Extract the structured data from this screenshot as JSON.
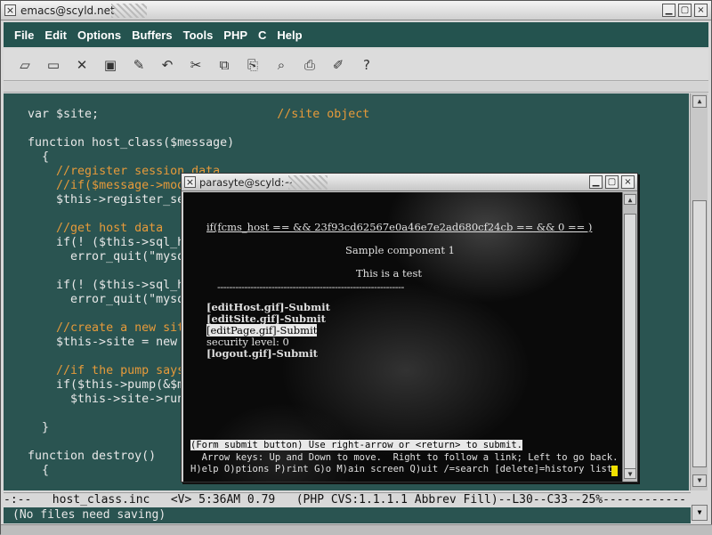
{
  "emacs": {
    "title": "emacs@scyld.net",
    "menu": [
      "File",
      "Edit",
      "Options",
      "Buffers",
      "Tools",
      "PHP",
      "C",
      "Help"
    ],
    "toolbar": [
      {
        "name": "new-file-icon",
        "glyph": "▱"
      },
      {
        "name": "open-folder-icon",
        "glyph": "▭"
      },
      {
        "name": "close-icon",
        "glyph": "✕"
      },
      {
        "name": "save-icon",
        "glyph": "▣"
      },
      {
        "name": "save-as-icon",
        "glyph": "✎"
      },
      {
        "name": "undo-icon",
        "glyph": "↶"
      },
      {
        "name": "cut-icon",
        "glyph": "✂"
      },
      {
        "name": "copy-icon",
        "glyph": "⧉"
      },
      {
        "name": "paste-icon",
        "glyph": "⎘"
      },
      {
        "name": "search-icon",
        "glyph": "⌕"
      },
      {
        "name": "print-icon",
        "glyph": "⎙"
      },
      {
        "name": "customize-icon",
        "glyph": "✐"
      },
      {
        "name": "help-icon",
        "glyph": "?"
      }
    ],
    "code_lines": [
      {
        "t": "var $site;                         ",
        "c": "//site object"
      },
      {
        "t": "",
        "c": ""
      },
      {
        "t": "function host_class($message)",
        "c": ""
      },
      {
        "t": "  {",
        "c": ""
      },
      {
        "t": "    ",
        "c": "//register session data"
      },
      {
        "t": "    ",
        "c": "//if($message->mod"
      },
      {
        "t": "    $this->register_se",
        "c": ""
      },
      {
        "t": "",
        "c": ""
      },
      {
        "t": "    ",
        "c": "//get host data"
      },
      {
        "t": "    if(! ($this->sql_h                                          \")) )",
        "c": ""
      },
      {
        "t": "      error_quit(\"mysq",
        "c": ""
      },
      {
        "t": "",
        "c": ""
      },
      {
        "t": "    if(! ($this->sql_h",
        "c": ""
      },
      {
        "t": "      error_quit(\"mysq",
        "c": ""
      },
      {
        "t": "",
        "c": ""
      },
      {
        "t": "    ",
        "c": "//create a new sit"
      },
      {
        "t": "    $this->site = new",
        "c": ""
      },
      {
        "t": "",
        "c": ""
      },
      {
        "t": "    ",
        "c": "//if the pump says"
      },
      {
        "t": "    if($this->pump(&$m",
        "c": ""
      },
      {
        "t": "      $this->site->run",
        "c": ""
      },
      {
        "t": "",
        "c": ""
      },
      {
        "t": "  }",
        "c": ""
      },
      {
        "t": "",
        "c": ""
      },
      {
        "t": "function destroy()",
        "c": ""
      },
      {
        "t": "  {",
        "c": ""
      }
    ],
    "modeline": "-:--   host_class.inc   <V> 5:36AM 0.79   (PHP CVS:1.1.1.1 Abbrev Fill)--L30--C33--25%------------",
    "minibuffer": "(No files need saving)"
  },
  "terminal": {
    "title": "parasyte@scyld:~",
    "condition": "if(fcms_host == && 23f93cd62567e0a46e7e2ad680cf24cb == && 0 == )",
    "heading": "Sample component 1",
    "subheading": "This is a test",
    "rule": "--------------------------------------------------------------",
    "links": [
      "[editHost.gif]-Submit",
      "[editSite.gif]-Submit",
      "[editPage.gif]-Submit"
    ],
    "security": "security level: 0",
    "logout": "[logout.gif]-Submit",
    "status": "(Form submit button) Use right-arrow or <return> to submit.",
    "help1": "  Arrow keys: Up and Down to move.  Right to follow a link; Left to go back.",
    "help2": "H)elp O)ptions P)rint G)o M)ain screen Q)uit /=search [delete]=history list"
  },
  "colors": {
    "editor_bg": "#2a5451",
    "comment": "#e69a3a",
    "menubar_bg": "#24534f"
  }
}
